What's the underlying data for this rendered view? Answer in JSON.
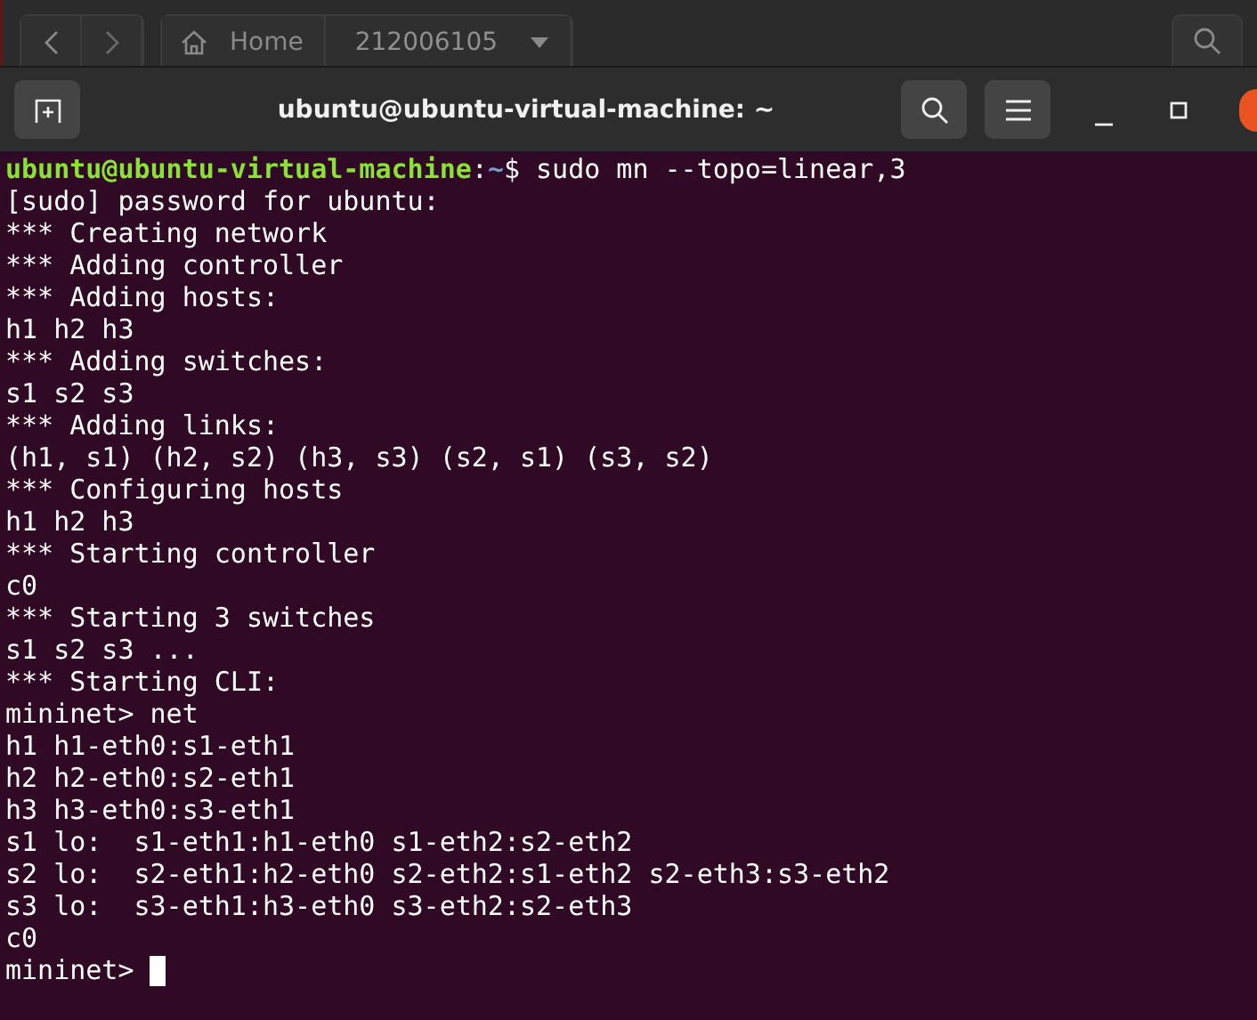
{
  "file_manager": {
    "path": [
      {
        "label": "Home",
        "kind": "home",
        "selected": false
      },
      {
        "label": "212006105",
        "kind": "folder",
        "selected": true
      }
    ]
  },
  "window": {
    "title": "ubuntu@ubuntu-virtual-machine: ~"
  },
  "terminal": {
    "lines": [
      {
        "kind": "prompt",
        "host": "ubuntu@ubuntu-virtual-machine",
        "sep": ":",
        "path": "~",
        "text": "$ sudo mn --topo=linear,3"
      },
      {
        "kind": "output",
        "text": "[sudo] password for ubuntu:"
      },
      {
        "kind": "output",
        "text": "*** Creating network"
      },
      {
        "kind": "output",
        "text": "*** Adding controller"
      },
      {
        "kind": "output",
        "text": "*** Adding hosts:"
      },
      {
        "kind": "output",
        "text": "h1 h2 h3"
      },
      {
        "kind": "output",
        "text": "*** Adding switches:"
      },
      {
        "kind": "output",
        "text": "s1 s2 s3"
      },
      {
        "kind": "output",
        "text": "*** Adding links:"
      },
      {
        "kind": "output",
        "text": "(h1, s1) (h2, s2) (h3, s3) (s2, s1) (s3, s2)"
      },
      {
        "kind": "output",
        "text": "*** Configuring hosts"
      },
      {
        "kind": "output",
        "text": "h1 h2 h3"
      },
      {
        "kind": "output",
        "text": "*** Starting controller"
      },
      {
        "kind": "output",
        "text": "c0"
      },
      {
        "kind": "output",
        "text": "*** Starting 3 switches"
      },
      {
        "kind": "output",
        "text": "s1 s2 s3 ..."
      },
      {
        "kind": "output",
        "text": "*** Starting CLI:"
      },
      {
        "kind": "output",
        "text": "mininet> net"
      },
      {
        "kind": "output",
        "text": "h1 h1-eth0:s1-eth1"
      },
      {
        "kind": "output",
        "text": "h2 h2-eth0:s2-eth1"
      },
      {
        "kind": "output",
        "text": "h3 h3-eth0:s3-eth1"
      },
      {
        "kind": "output",
        "text": "s1 lo:  s1-eth1:h1-eth0 s1-eth2:s2-eth2"
      },
      {
        "kind": "output",
        "text": "s2 lo:  s2-eth1:h2-eth0 s2-eth2:s1-eth2 s2-eth3:s3-eth2"
      },
      {
        "kind": "output",
        "text": "s3 lo:  s3-eth1:h3-eth0 s3-eth2:s2-eth3"
      },
      {
        "kind": "output",
        "text": "c0"
      },
      {
        "kind": "input",
        "text": "mininet>",
        "cursor": true
      }
    ]
  }
}
